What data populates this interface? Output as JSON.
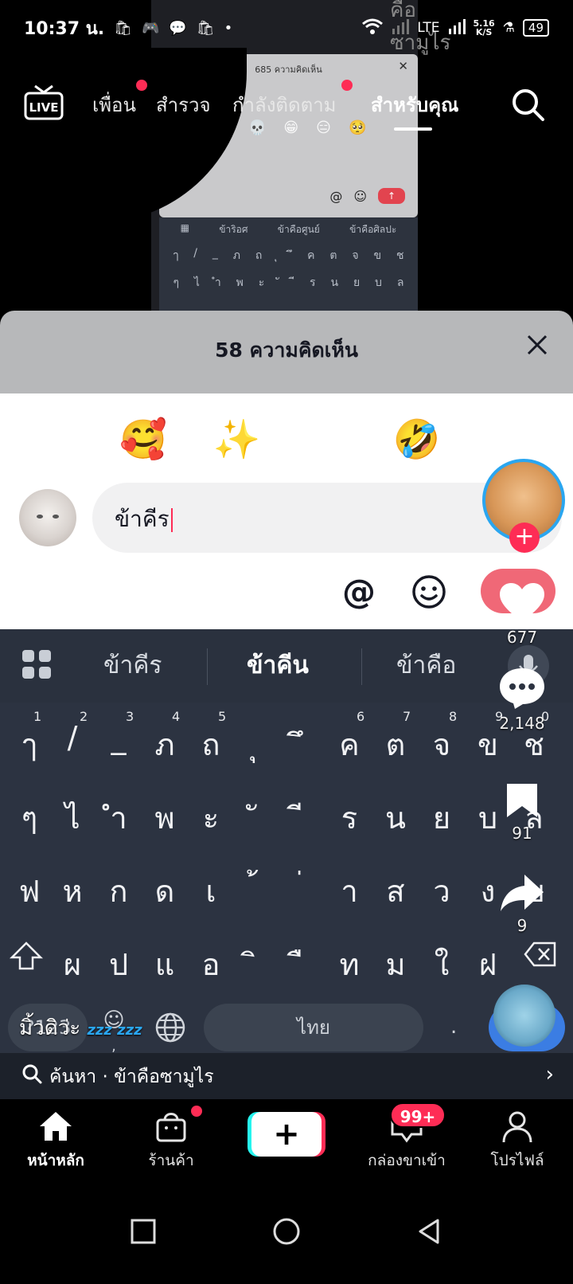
{
  "status_bar": {
    "time": "10:37 น.",
    "network": "LTE",
    "speed_value": "5.16",
    "speed_unit": "K/S",
    "battery": "49"
  },
  "background": {
    "top_text": "คือซามูไร",
    "panel_title": "685 ความคิดเห็น",
    "suggestions": [
      "ข้าริอศ",
      "ข้าคือศูนย์",
      "ข้าคือศิลปะ"
    ]
  },
  "top_nav": {
    "live_label": "LIVE",
    "tabs": [
      {
        "label": "เพื่อน"
      },
      {
        "label": "สำรวจ"
      },
      {
        "label": "กำลังติดตาม"
      },
      {
        "label": "สำหรับคุณ"
      }
    ]
  },
  "comment_sheet": {
    "title": "58 ความคิดเห็น",
    "emojis": [
      "😔",
      "🥰",
      "✨",
      "😁",
      "🤣",
      "😉"
    ],
    "input_value": "ข้าคีร",
    "at_label": "@"
  },
  "keyboard": {
    "suggestions": [
      "ข้าคีร",
      "ข้าคีน",
      "ข้าคือ"
    ],
    "row1": [
      "ๅ",
      "/",
      "_",
      "ภ",
      "ถ",
      "ุ",
      "ึ",
      "ค",
      "ต",
      "จ",
      "ข",
      "ช"
    ],
    "row1_nums": [
      "1",
      "2",
      "3",
      "4",
      "5",
      "6",
      "7",
      "8",
      "9",
      "0"
    ],
    "row2": [
      "ๆ",
      "ไ",
      "ำ",
      "พ",
      "ะ",
      "ั",
      "ี",
      "ร",
      "น",
      "ย",
      "บ",
      "ล"
    ],
    "row3": [
      "ฟ",
      "ห",
      "ก",
      "ด",
      "เ",
      "้",
      "่",
      "า",
      "ส",
      "ว",
      "ง",
      "ฃ"
    ],
    "row4": [
      "ผ",
      "ป",
      "แ",
      "อ",
      "ิ",
      "ื",
      "ท",
      "ม",
      "ใ",
      "ฝ"
    ],
    "symbols_label": "?123",
    "space_label": "ไทย",
    "comma": ",",
    "period": "."
  },
  "search_strip": {
    "text": "ค้นหา · ข้าคือซามูไร"
  },
  "rail": {
    "likes": "677",
    "comments": "2,148",
    "saves": "91",
    "shares": "9"
  },
  "caption": {
    "text": "มิ้วดิว่ะ",
    "zzz": "zzz zzz"
  },
  "bottom_nav": {
    "home": "หน้าหลัก",
    "shop": "ร้านค้า",
    "inbox": "กล่องขาเข้า",
    "inbox_badge": "99+",
    "profile": "โปรไฟล์"
  },
  "colors": {
    "accent": "#fe2c55",
    "keyboard_bg": "#2c3341",
    "enter_key": "#3b7de3",
    "sheet_header": "#b7b8ba"
  }
}
